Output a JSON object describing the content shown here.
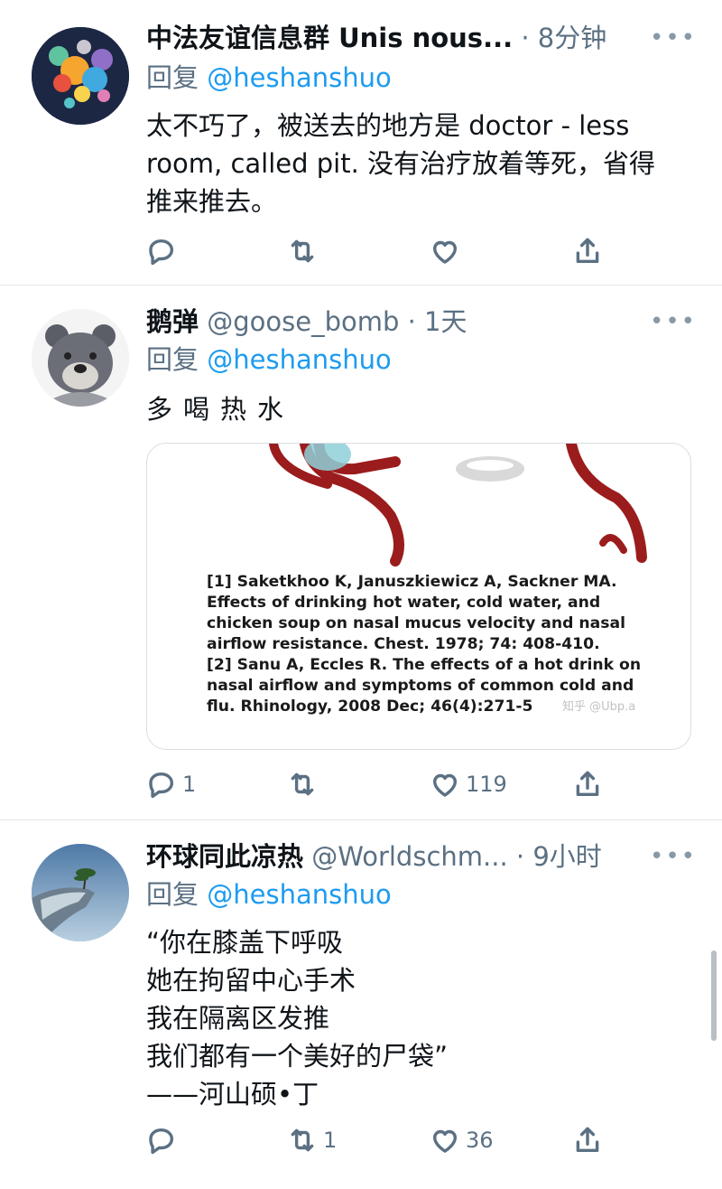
{
  "tweets": [
    {
      "name": "中法友谊信息群 Unis nous...",
      "handle": "",
      "time": "8分钟",
      "reply_prefix": "回复",
      "reply_to": "@heshanshuo",
      "lines": [
        "太不巧了，被送去的地方是 doctor - less",
        "room, called pit. 没有治疗放着等死，省得",
        "推来推去。"
      ],
      "reply_count": "",
      "retweet_count": "",
      "like_count": ""
    },
    {
      "name": "鹅弹",
      "handle": "@goose_bomb",
      "time": "1天",
      "reply_prefix": "回复",
      "reply_to": "@heshanshuo",
      "lines": [
        "多喝热水"
      ],
      "reply_count": "1",
      "retweet_count": "",
      "like_count": "119",
      "media": {
        "citation_lines": [
          "[1] Saketkhoo K, Januszkiewicz A, Sackner MA.",
          "Effects of drinking hot water, cold water, and",
          "chicken soup on nasal mucus velocity and nasal",
          "airflow resistance. Chest. 1978; 74: 408-410.",
          "[2] Sanu A, Eccles R. The effects of a hot drink on",
          "nasal airflow and symptoms of common cold and",
          "flu. Rhinology, 2008 Dec; 46(4):271-5"
        ],
        "watermark": "知乎 @Ubp.a"
      }
    },
    {
      "name": "环球同此凉热",
      "handle": "@Worldschm...",
      "time": "9小时",
      "reply_prefix": "回复",
      "reply_to": "@heshanshuo",
      "lines": [
        "“你在膝盖下呼吸",
        "她在拘留中心手术",
        "我在隔离区发推",
        "我们都有一个美好的尸袋”",
        "——河山硕•丁"
      ],
      "reply_count": "",
      "retweet_count": "1",
      "like_count": "36"
    }
  ],
  "icons": [
    "reply-icon",
    "retweet-icon",
    "like-icon",
    "share-icon",
    "more-icon"
  ],
  "colors": {
    "link": "#1d9bf0",
    "secondary": "#5b7083",
    "text": "#0f1419"
  }
}
